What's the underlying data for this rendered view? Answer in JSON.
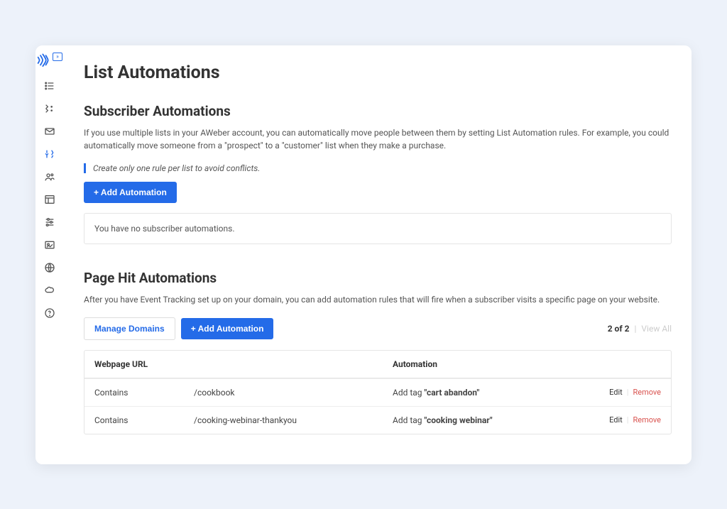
{
  "page": {
    "title": "List Automations"
  },
  "sections": {
    "subscriber": {
      "heading": "Subscriber Automations",
      "intro": "If you use multiple lists in your AWeber account, you can automatically move people between them by setting List Automation rules. For example, you could automatically move someone from a \"prospect\" to a \"customer\" list when they make a purchase.",
      "note": "Create only one rule per list to avoid conflicts.",
      "add_button": "+ Add Automation",
      "empty_message": "You have no subscriber automations."
    },
    "pagehit": {
      "heading": "Page Hit Automations",
      "intro": "After you have Event Tracking set up on your domain, you can add automation rules that will fire when a subscriber visits a specific page on your website.",
      "manage_button": "Manage Domains",
      "add_button": "+ Add Automation",
      "count_label": "2 of 2",
      "view_all_label": "View All",
      "columns": {
        "url": "Webpage URL",
        "automation": "Automation"
      },
      "rows": [
        {
          "match": "Contains",
          "url": "/cookbook",
          "action_prefix": "Add tag ",
          "action_tag": "\"cart abandon\""
        },
        {
          "match": "Contains",
          "url": "/cooking-webinar-thankyou",
          "action_prefix": "Add tag ",
          "action_tag": "\"cooking webinar\""
        }
      ],
      "edit_label": "Edit",
      "remove_label": "Remove"
    }
  }
}
